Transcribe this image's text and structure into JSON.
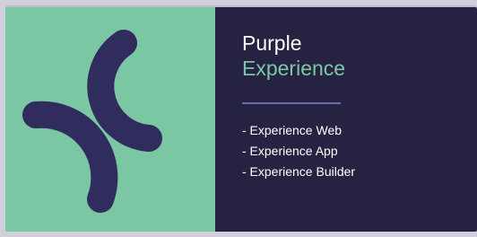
{
  "card": {
    "title_primary": "Purple",
    "title_secondary": "Experience",
    "features": [
      "- Experience Web",
      "- Experience App",
      "- Experience Builder"
    ]
  },
  "logo": {
    "icon": "purple-experience-logo-icon"
  },
  "colors": {
    "logo_background": "#7cc7a3",
    "panel_background": "#262242",
    "title_accent": "#7cc7a3",
    "divider": "#6b6ba6",
    "logo_arcs": "#312c5e"
  }
}
